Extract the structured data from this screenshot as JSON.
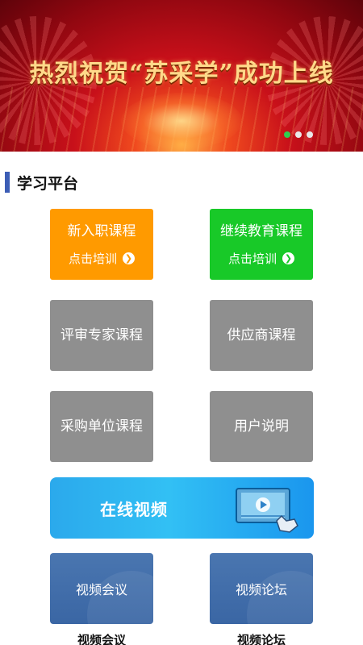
{
  "banner": {
    "title": "热烈祝贺“苏采学”成功上线",
    "dot_count": 3,
    "active_dot": 1
  },
  "section": {
    "title": "学习平台"
  },
  "tiles": {
    "new_staff": {
      "label": "新入职课程",
      "sub": "点击培训"
    },
    "continuing": {
      "label": "继续教育课程",
      "sub": "点击培训"
    },
    "reviewer": {
      "label": "评审专家课程"
    },
    "supplier": {
      "label": "供应商课程"
    },
    "purchaser": {
      "label": "采购单位课程"
    },
    "user_guide": {
      "label": "用户说明"
    }
  },
  "video_banner": {
    "label": "在线视频",
    "icon": "video-player-icon"
  },
  "bottom_tiles": {
    "video_meeting": {
      "label": "视频会议",
      "caption": "视频会议"
    },
    "video_forum": {
      "label": "视频论坛",
      "caption": "视频论坛"
    }
  },
  "colors": {
    "orange": "#ff9a00",
    "green": "#18c928",
    "gray": "#8f8f8f",
    "blue": "#3a66a4",
    "accent_bar": "#3c5db5",
    "dot_active": "#2fcf4f"
  }
}
